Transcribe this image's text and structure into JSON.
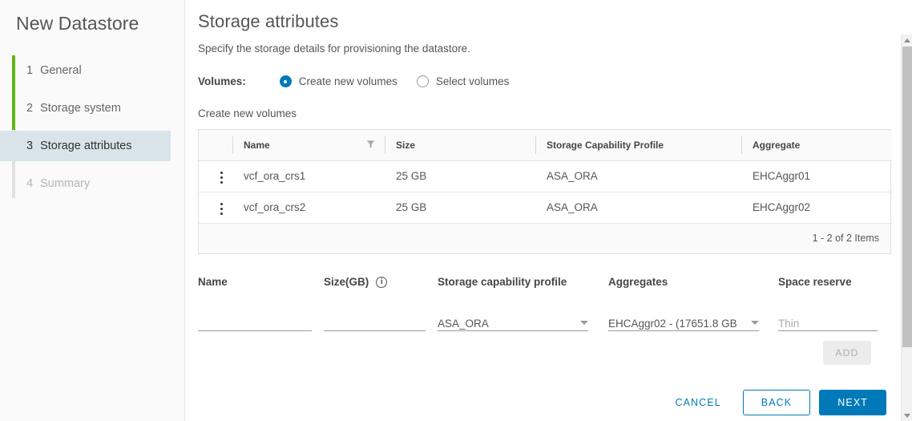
{
  "wizard": {
    "title": "New Datastore",
    "steps": [
      {
        "num": "1",
        "label": "General",
        "state": "done"
      },
      {
        "num": "2",
        "label": "Storage system",
        "state": "done"
      },
      {
        "num": "3",
        "label": "Storage attributes",
        "state": "active"
      },
      {
        "num": "4",
        "label": "Summary",
        "state": "disabled"
      }
    ]
  },
  "main": {
    "title": "Storage attributes",
    "subtitle": "Specify the storage details for provisioning the datastore.",
    "volumes": {
      "label": "Volumes:",
      "options": [
        {
          "label": "Create new volumes",
          "selected": true
        },
        {
          "label": "Select volumes",
          "selected": false
        }
      ]
    },
    "section_label": "Create new volumes"
  },
  "table": {
    "columns": [
      "Name",
      "Size",
      "Storage Capability Profile",
      "Aggregate"
    ],
    "rows": [
      {
        "name": "vcf_ora_crs1",
        "size": "25 GB",
        "scp": "ASA_ORA",
        "aggregate": "EHCAggr01"
      },
      {
        "name": "vcf_ora_crs2",
        "size": "25 GB",
        "scp": "ASA_ORA",
        "aggregate": "EHCAggr02"
      }
    ],
    "footer_count": "1 - 2 of 2 Items"
  },
  "form": {
    "name": {
      "label": "Name",
      "value": "",
      "placeholder": ""
    },
    "size": {
      "label": "Size(GB)",
      "value": "",
      "placeholder": ""
    },
    "scp": {
      "label": "Storage capability profile",
      "value": "ASA_ORA"
    },
    "aggregates": {
      "label": "Aggregates",
      "value": "EHCAggr02 - (17651.8 GB"
    },
    "space_reserve": {
      "label": "Space reserve",
      "value": "",
      "placeholder": "Thin"
    },
    "add_label": "ADD"
  },
  "footer": {
    "cancel": "CANCEL",
    "back": "BACK",
    "next": "NEXT"
  },
  "colors": {
    "accent": "#0079b8",
    "progress": "#60b515",
    "active_step_bg": "#d9e4ea"
  }
}
